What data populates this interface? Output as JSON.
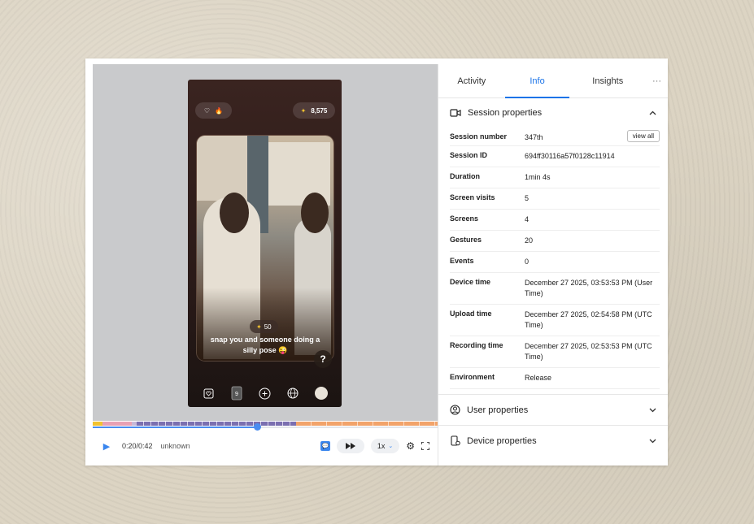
{
  "phone": {
    "top_score": "8,575",
    "bonus": "50",
    "caption": "snap you and someone doing a silly pose 😜",
    "help_label": "?",
    "deck_count": "9"
  },
  "controls": {
    "time": "0:20/0:42",
    "status": "unknown",
    "speed": "1x",
    "progress_fraction": 0.476
  },
  "tabs": [
    {
      "label": "Activity"
    },
    {
      "label": "Info"
    },
    {
      "label": "Insights"
    },
    {
      "label": "···"
    }
  ],
  "session": {
    "title": "Session properties",
    "view_all": "view all",
    "rows": [
      {
        "key": "Session number",
        "value": "347th"
      },
      {
        "key": "Session ID",
        "value": "694ff30116a57f0128c11914"
      },
      {
        "key": "Duration",
        "value": "1min 4s"
      },
      {
        "key": "Screen visits",
        "value": "5"
      },
      {
        "key": "Screens",
        "value": "4"
      },
      {
        "key": "Gestures",
        "value": "20"
      },
      {
        "key": "Events",
        "value": "0"
      },
      {
        "key": "Device time",
        "value": "December 27 2025, 03:53:53 PM (User Time)"
      },
      {
        "key": "Upload time",
        "value": "December 27 2025, 02:54:58 PM (UTC Time)"
      },
      {
        "key": "Recording time",
        "value": "December 27 2025, 02:53:53 PM (UTC Time)"
      },
      {
        "key": "Environment",
        "value": "Release"
      }
    ]
  },
  "user_properties": {
    "title": "User properties"
  },
  "device_properties": {
    "title": "Device properties"
  },
  "colors": {
    "accent": "#1a73e8",
    "play_blue": "#3a86ee",
    "timeline_yellow": "#f2c230",
    "timeline_pink": "#e8a0b4",
    "timeline_purple": "#7b6fb0",
    "timeline_orange": "#f2a36a"
  }
}
